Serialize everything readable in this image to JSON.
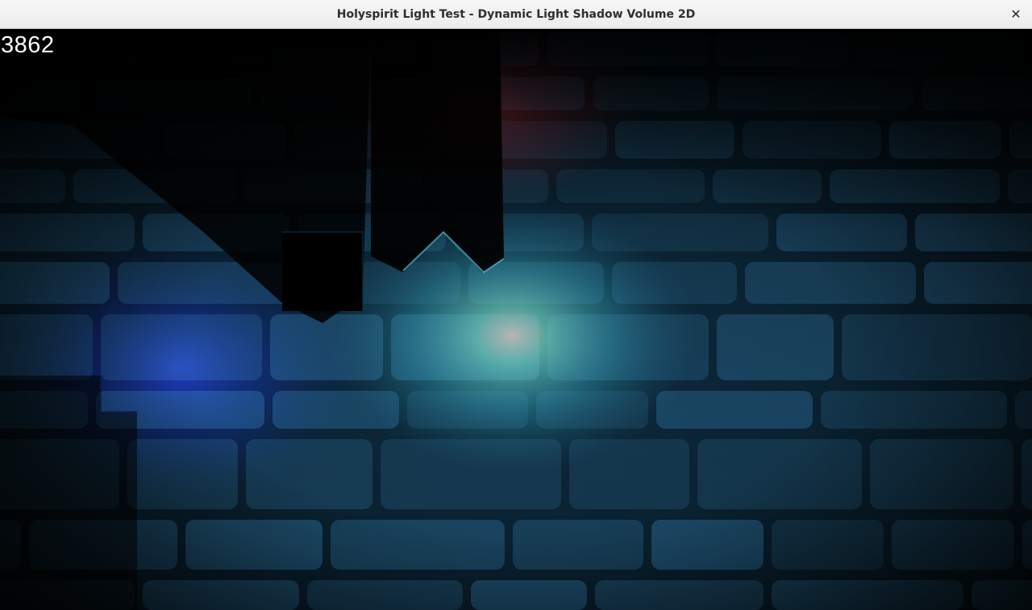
{
  "window": {
    "title": "Holyspirit Light Test - Dynamic Light Shadow Volume 2D",
    "close_icon": "close-icon",
    "close_glyph": "✕"
  },
  "scene": {
    "counter": "3862",
    "background": "stone-brick-wall",
    "lights": [
      {
        "name": "red-light",
        "color": "#ff1a1a"
      },
      {
        "name": "blue-light",
        "color": "#1a2cff"
      },
      {
        "name": "cyan-light",
        "color": "#3fe0c8"
      }
    ],
    "wall_tint": "#1f5a80",
    "mortar_color": "#04121c"
  }
}
